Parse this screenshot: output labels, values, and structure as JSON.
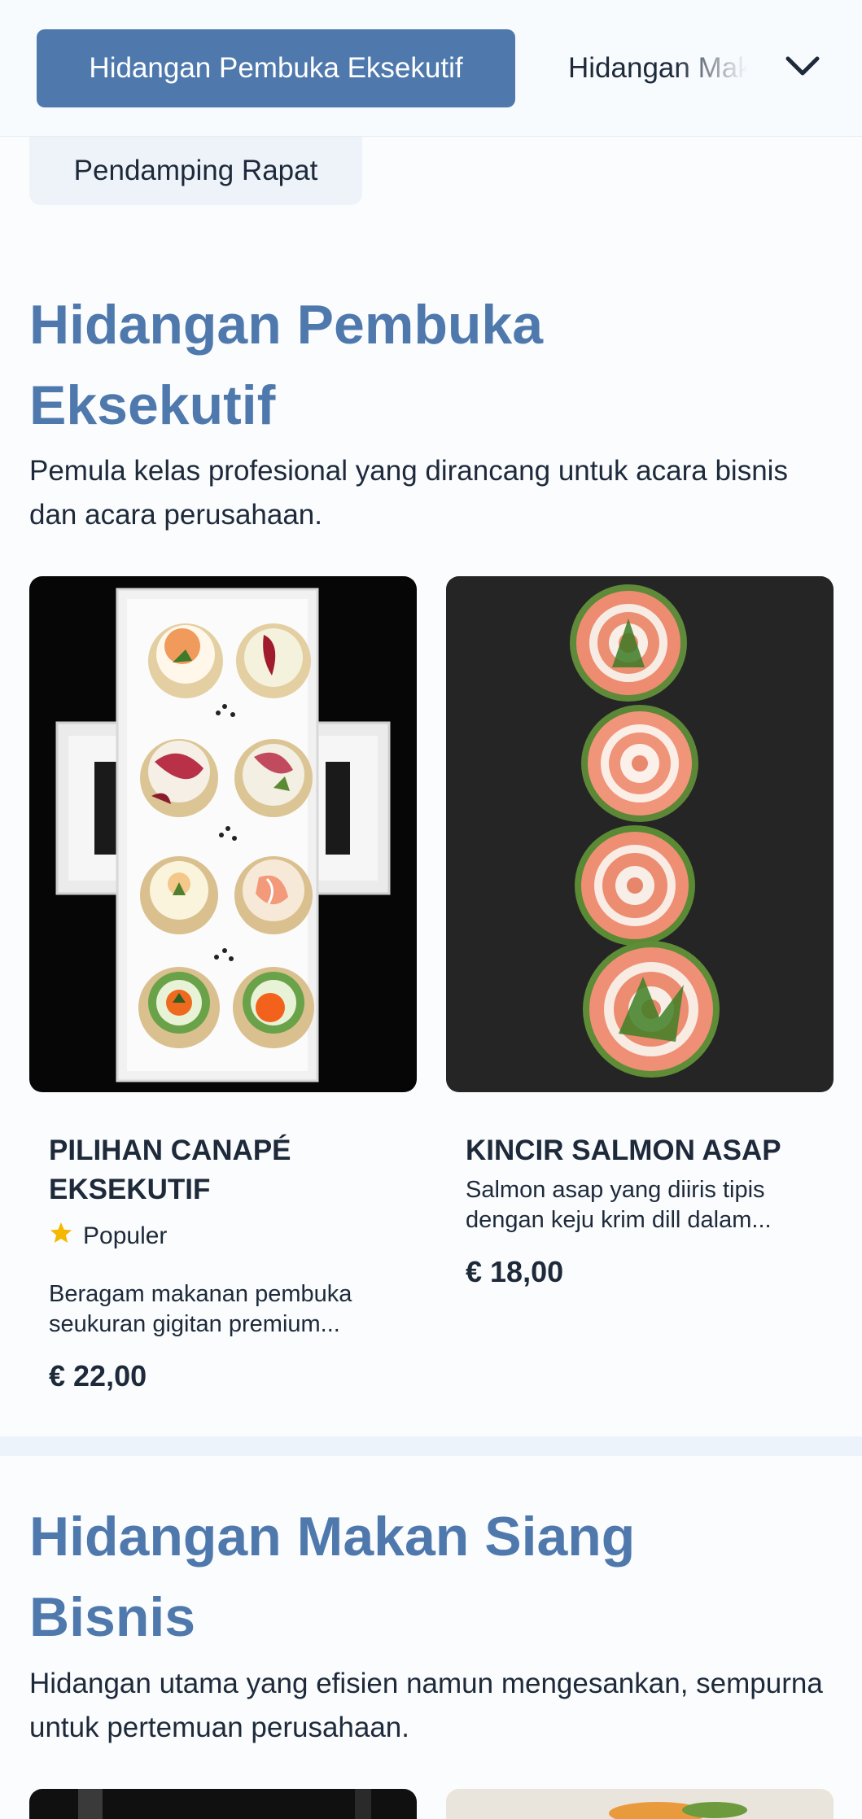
{
  "nav": {
    "active_category": "Hidangan Pembuka Eksekutif",
    "next_category": "Hidangan Makan Siang Bisnis",
    "chip_category": "Pendamping Rapat",
    "dropdown_icon": "chevron-down-icon"
  },
  "sections": [
    {
      "title": "Hidangan Pembuka Eksekutif",
      "description": "Pemula kelas profesional yang dirancang untuk acara bisnis dan acara perusahaan.",
      "items": [
        {
          "name": "PILIHAN CANAPÉ EKSEKUTIF",
          "badge": "Populer",
          "badge_icon": "star-icon",
          "description": "Beragam makanan pembuka seukuran gigitan premium...",
          "price": "€ 22,00"
        },
        {
          "name": "KINCIR SALMON ASAP",
          "description": "Salmon asap yang diiris tipis dengan keju krim dill dalam...",
          "price": "€ 18,00"
        }
      ]
    },
    {
      "title": "Hidangan Makan Siang Bisnis",
      "description": "Hidangan utama yang efisien namun mengesankan, sempurna untuk pertemuan perusahaan."
    }
  ],
  "colors": {
    "accent": "#4f79ad",
    "text": "#1e2a3a",
    "background": "#fafcfe",
    "star": "#f5b800"
  }
}
